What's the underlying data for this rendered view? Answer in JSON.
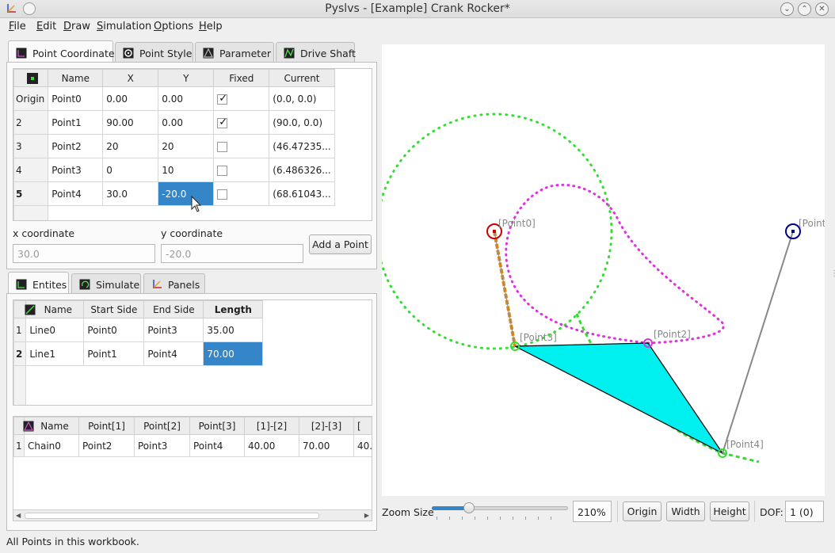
{
  "window": {
    "title": "Pyslvs - [Example] Crank Rocker*"
  },
  "menu": [
    "File",
    "Edit",
    "Draw",
    "Simulation",
    "Options",
    "Help"
  ],
  "top_tabs": [
    "Point Coordinate",
    "Point Style",
    "Parameter",
    "Drive Shaft"
  ],
  "points_table": {
    "headers": [
      "Name",
      "X",
      "Y",
      "Fixed",
      "Current"
    ],
    "rows": [
      {
        "id": "Origin",
        "name": "Point0",
        "x": "0.00",
        "y": "0.00",
        "fixed": true,
        "current": "(0.0, 0.0)"
      },
      {
        "id": "2",
        "name": "Point1",
        "x": "90.00",
        "y": "0.00",
        "fixed": true,
        "current": "(90.0, 0.0)"
      },
      {
        "id": "3",
        "name": "Point2",
        "x": "20",
        "y": "20",
        "fixed": false,
        "current": "(46.47235..."
      },
      {
        "id": "4",
        "name": "Point3",
        "x": "0",
        "y": "10",
        "fixed": false,
        "current": "(6.486326..."
      },
      {
        "id": "5",
        "name": "Point4",
        "x": "30.0",
        "y": "-20.0",
        "fixed": false,
        "current": "(68.61043..."
      }
    ]
  },
  "coord_form": {
    "x_label": "x coordinate",
    "y_label": "y coordinate",
    "x_value": "30.0",
    "y_value": "-20.0",
    "add_button": "Add a Point"
  },
  "bottom_tabs": [
    "Entites",
    "Simulate",
    "Panels"
  ],
  "lines_table": {
    "headers": [
      "Name",
      "Start Side",
      "End Side",
      "Length"
    ],
    "rows": [
      {
        "id": "1",
        "name": "Line0",
        "start": "Point0",
        "end": "Point3",
        "length": "35.00"
      },
      {
        "id": "2",
        "name": "Line1",
        "start": "Point1",
        "end": "Point4",
        "length": "70.00"
      }
    ]
  },
  "chains_table": {
    "headers": [
      "Name",
      "Point[1]",
      "Point[2]",
      "Point[3]",
      "[1]-[2]",
      "[2]-[3]",
      "["
    ],
    "rows": [
      {
        "id": "1",
        "name": "Chain0",
        "p1": "Point2",
        "p2": "Point3",
        "p3": "Point4",
        "d12": "40.00",
        "d23": "70.00",
        "d31": "40.("
      }
    ]
  },
  "canvas": {
    "labels": {
      "p0": "[Point0]",
      "p1": "[Point",
      "p2": "[Point2]",
      "p3": "[Point3]",
      "p4": "[Point4]"
    },
    "colors": {
      "green_path": "#33dd33",
      "magenta_path": "#dd33dd",
      "triangle": "#00f0f0",
      "crank": "#e08a1c",
      "p0": "#cc0000",
      "p1": "#00008b"
    }
  },
  "bottom_controls": {
    "zoom_label": "Zoom Size",
    "zoom_value": "210%",
    "zoom_level": 0.25,
    "origin": "Origin",
    "width": "Width",
    "height": "Height",
    "dof_label": "DOF:",
    "dof_value": "1 (0)"
  },
  "status": "All Points in this workbook."
}
